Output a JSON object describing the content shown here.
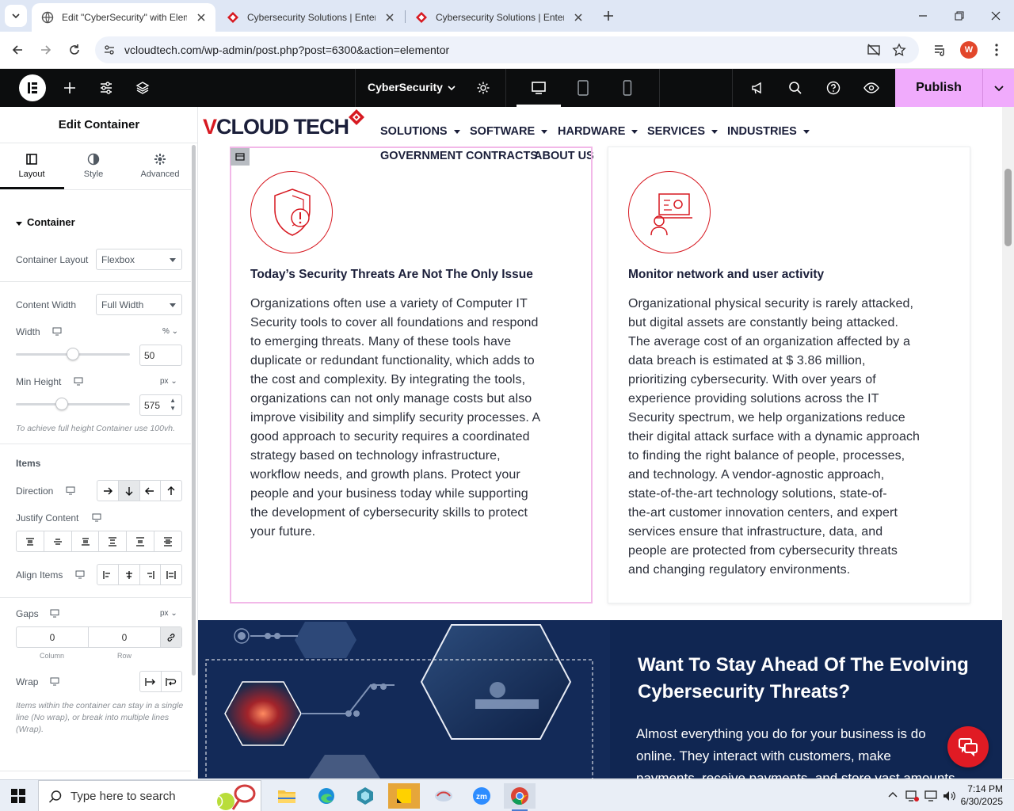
{
  "browser": {
    "tabs": [
      {
        "title": "Edit \"CyberSecurity\" with Elementor",
        "active": true
      },
      {
        "title": "Cybersecurity Solutions | Enterprise",
        "active": false
      },
      {
        "title": "Cybersecurity Solutions | Enterprise",
        "active": false
      }
    ],
    "url": "vcloudtech.com/wp-admin/post.php?post=6300&action=elementor",
    "profile_initial": "W"
  },
  "editor": {
    "page_title": "CyberSecurity",
    "publish_label": "Publish"
  },
  "panel": {
    "title": "Edit Container",
    "tabs": [
      {
        "label": "Layout",
        "icon": "layout-icon"
      },
      {
        "label": "Style",
        "icon": "contrast-icon"
      },
      {
        "label": "Advanced",
        "icon": "gear-icon"
      }
    ],
    "section": "Container",
    "container_layout": {
      "label": "Container Layout",
      "value": "Flexbox"
    },
    "content_width": {
      "label": "Content Width",
      "value": "Full Width"
    },
    "width": {
      "label": "Width",
      "unit": "%",
      "value": "50",
      "slider_fraction": 0.5
    },
    "min_height": {
      "label": "Min Height",
      "unit": "px",
      "value": "575",
      "slider_fraction": 0.4
    },
    "min_height_hint": "To achieve full height Container use 100vh.",
    "items_heading": "Items",
    "direction_label": "Direction",
    "justify_label": "Justify Content",
    "align_label": "Align Items",
    "gaps": {
      "label": "Gaps",
      "unit": "px",
      "column": "0",
      "row": "0",
      "column_label": "Column",
      "row_label": "Row"
    },
    "wrap_label": "Wrap",
    "wrap_hint": "Items within the container can stay in a single line (No wrap), or break into multiple lines (Wrap)."
  },
  "site": {
    "logo": {
      "v": "V",
      "rest": "CLOUD TECH"
    },
    "nav": [
      {
        "label": "SOLUTIONS",
        "dropdown": true
      },
      {
        "label": "SOFTWARE",
        "dropdown": true
      },
      {
        "label": "HARDWARE",
        "dropdown": true
      },
      {
        "label": "SERVICES",
        "dropdown": true
      },
      {
        "label": "INDUSTRIES",
        "dropdown": true
      },
      {
        "label": "GOVERNMENT CONTRACTS",
        "dropdown": false
      },
      {
        "label": "ABOUT US",
        "dropdown": false
      }
    ],
    "cards": [
      {
        "title": "Today’s Security Threats Are Not The Only Issue",
        "lines": [
          "Organizations often use a variety of Computer IT",
          "Security tools to cover all foundations and respond",
          "to emerging threats. Many of these tools have",
          "duplicate or redundant functionality, which adds to",
          "the cost and complexity. By integrating the tools,",
          "organizations can not only manage costs but also",
          "improve visibility and simplify security processes. A",
          "good approach to security requires a coordinated",
          "strategy based on technology infrastructure,",
          "workflow needs, and growth plans. Protect your",
          "people and your business today while supporting",
          "the development of cybersecurity skills to protect",
          "your future."
        ]
      },
      {
        "title": "Monitor network and user activity",
        "lines": [
          "Organizational physical security is rarely attacked,",
          "but digital assets are constantly being attacked.",
          "The average cost of an organization affected by a",
          "data breach is estimated at $ 3.86 million,",
          "prioritizing cybersecurity. With over years of",
          "experience providing solutions across the IT",
          "Security spectrum, we help organizations reduce",
          "their digital attack surface with a dynamic approach",
          "to finding the right balance of people, processes,",
          "and technology. A vendor-agnostic approach,",
          "state-of-the-art technology solutions, state-of-",
          "the-art customer innovation centers, and expert",
          "services ensure that infrastructure, data, and",
          "people are protected from cybersecurity threats",
          "and changing regulatory environments."
        ]
      }
    ],
    "banner": {
      "heading": "Want To Stay Ahead Of The Evolving Cybersecurity Threats?",
      "lines": [
        "Almost everything you do for your business is do",
        "online. They interact with customers, make",
        "payments, receive payments, and store vast amounts"
      ]
    }
  },
  "taskbar": {
    "search_placeholder": "Type here to search",
    "time": "7:14 PM",
    "date": "6/30/2025"
  },
  "colors": {
    "brand_red": "#d71921",
    "navy": "#1b1f3a",
    "publish_pink": "#f0abfc",
    "banner_navy": "#102652"
  }
}
